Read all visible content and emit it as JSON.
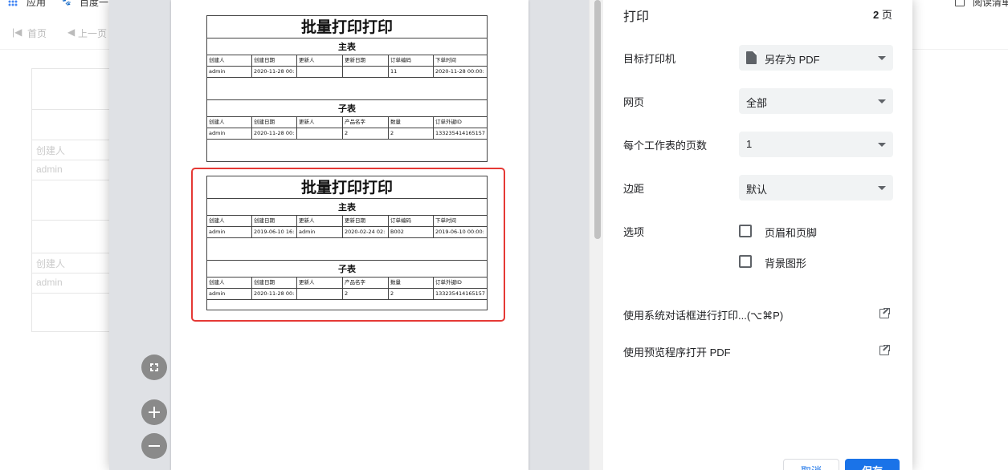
{
  "browser": {
    "bookmarks": [
      {
        "label": "应用"
      },
      {
        "label": "百度一"
      }
    ],
    "reading_list_label": "阅读清单"
  },
  "background_page": {
    "toolbar": {
      "first_label": "首页",
      "prev_label": "上一页"
    },
    "table_cells": [
      "创建人",
      "admin",
      "创建人",
      "admin"
    ]
  },
  "print_dialog": {
    "title": "打印",
    "page_count": "2",
    "page_unit": "页",
    "rows": {
      "destination": {
        "label": "目标打印机",
        "value": "另存为 PDF"
      },
      "pages": {
        "label": "网页",
        "value": "全部"
      },
      "pages_per_sheet": {
        "label": "每个工作表的页数",
        "value": "1"
      },
      "margins": {
        "label": "边距",
        "value": "默认"
      },
      "options": {
        "label": "选项"
      }
    },
    "options": {
      "header_footer": "页眉和页脚",
      "background_graphics": "背景图形"
    },
    "links": {
      "system_dialog": "使用系统对话框进行打印...(⌥⌘P)",
      "open_preview": "使用预览程序打开 PDF"
    },
    "buttons": {
      "cancel": "取消",
      "save": "保存"
    }
  },
  "preview": {
    "sheets": [
      {
        "title": "批量打印打印",
        "main_section": "主表",
        "main_headers": [
          "创建人",
          "创建日期",
          "更新人",
          "更新日期",
          "订单编码",
          "下单时间"
        ],
        "main_values": [
          "admin",
          "2020-11-28 00:",
          "",
          "",
          "11",
          "2020-11-28 00:00:"
        ],
        "child_section": "子表",
        "child_headers": [
          "创建人",
          "创建日期",
          "更新人",
          "产品名字",
          "数量",
          "订单外键ID"
        ],
        "child_values": [
          "admin",
          "2020-11-28 00:",
          "",
          "2",
          "2",
          "133235414165157"
        ]
      },
      {
        "title": "批量打印打印",
        "main_section": "主表",
        "main_headers": [
          "创建人",
          "创建日期",
          "更新人",
          "更新日期",
          "订单编码",
          "下单时间"
        ],
        "main_values": [
          "admin",
          "2019-06-10 16:",
          "admin",
          "2020-02-24 02:",
          "B002",
          "2019-06-10 00:00:"
        ],
        "child_section": "子表",
        "child_headers": [
          "创建人",
          "创建日期",
          "更新人",
          "产品名字",
          "数量",
          "订单外键ID"
        ],
        "child_values": [
          "admin",
          "2020-11-28 00:",
          "",
          "2",
          "2",
          "133235414165157"
        ]
      }
    ],
    "highlight_color": "#e53935"
  },
  "colors": {
    "accent": "#1a73e8",
    "preview_bg": "#dfe1e5",
    "control_bg": "#f1f3f4"
  }
}
